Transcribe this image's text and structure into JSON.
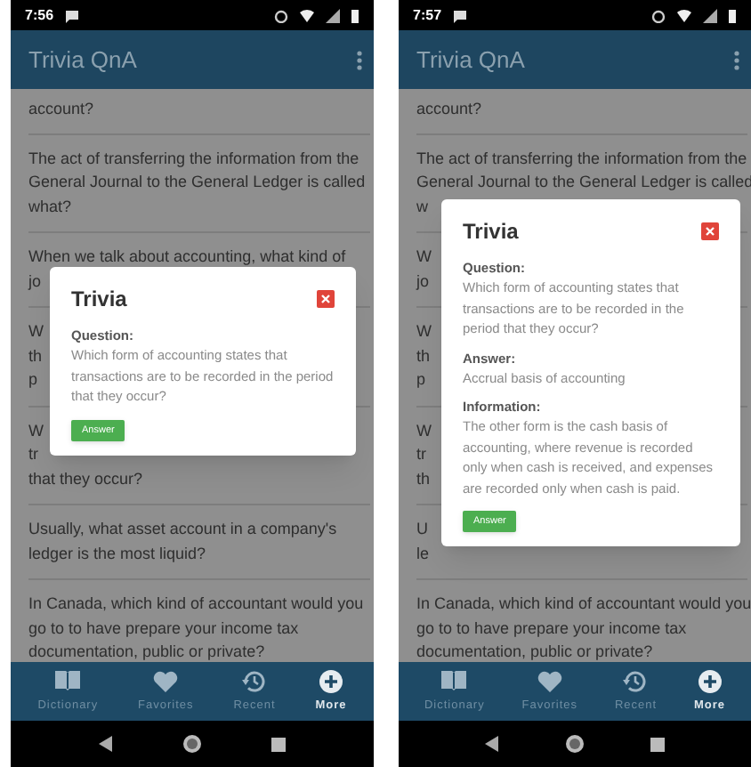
{
  "screens": [
    {
      "status_bar": {
        "time": "7:56"
      },
      "app_bar": {
        "title": "Trivia QnA"
      },
      "questions": [
        {
          "lines": [
            "account?"
          ]
        },
        {
          "lines": [
            "The act of transferring the information from the",
            "General Journal to the General Ledger is called",
            "what?"
          ]
        },
        {
          "lines": [
            "When we talk about accounting, what kind of",
            "jo"
          ]
        },
        {
          "lines": [
            "W",
            "th",
            "p"
          ]
        },
        {
          "lines": [
            "W",
            "tr",
            "that they occur?"
          ]
        },
        {
          "lines": [
            "Usually, what asset account in a company's",
            "ledger is the most liquid?"
          ]
        },
        {
          "lines": [
            "In Canada, which kind of accountant would you",
            "go to to have prepare your income tax",
            "documentation, public or private?"
          ]
        }
      ],
      "dialog": {
        "title": "Trivia",
        "sections": [
          {
            "label": "Question:",
            "text": "Which form of accounting states that transactions are to be recorded in the period that they occur?"
          }
        ],
        "button": "Answer"
      },
      "bottom_nav": [
        {
          "label": "Dictionary",
          "kind": "book",
          "selected": false
        },
        {
          "label": "Favorites",
          "kind": "heart",
          "selected": false
        },
        {
          "label": "Recent",
          "kind": "history",
          "selected": false
        },
        {
          "label": "More",
          "kind": "plus",
          "selected": true
        }
      ]
    },
    {
      "status_bar": {
        "time": "7:57"
      },
      "app_bar": {
        "title": "Trivia QnA"
      },
      "questions": [
        {
          "lines": [
            "account?"
          ]
        },
        {
          "lines": [
            "The act of transferring the information from the",
            "General Journal to the General Ledger is called",
            "w"
          ]
        },
        {
          "lines": [
            "W",
            "jo"
          ]
        },
        {
          "lines": [
            "W",
            "th",
            "p"
          ]
        },
        {
          "lines": [
            "W",
            "tr",
            "th"
          ]
        },
        {
          "lines": [
            "U",
            "le"
          ]
        },
        {
          "lines": [
            "In Canada, which kind of accountant would you",
            "go to to have prepare your income tax",
            "documentation, public or private?"
          ]
        }
      ],
      "dialog": {
        "title": "Trivia",
        "sections": [
          {
            "label": "Question:",
            "text": "Which form of accounting states that transactions are to be recorded in the period that they occur?"
          },
          {
            "label": "Answer:",
            "text": "Accrual basis of accounting"
          },
          {
            "label": "Information:",
            "text": "The other form is the cash basis of accounting, where revenue is recorded only when cash is received, and expenses are recorded only when cash is paid."
          }
        ],
        "button": "Answer"
      },
      "bottom_nav": [
        {
          "label": "Dictionary",
          "kind": "book",
          "selected": false
        },
        {
          "label": "Favorites",
          "kind": "heart",
          "selected": false
        },
        {
          "label": "Recent",
          "kind": "history",
          "selected": false
        },
        {
          "label": "More",
          "kind": "plus",
          "selected": true
        }
      ]
    }
  ]
}
